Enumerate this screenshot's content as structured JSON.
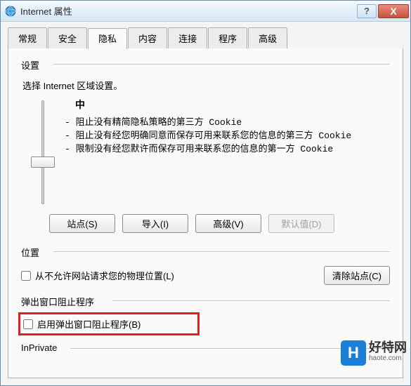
{
  "window": {
    "title": "Internet 属性",
    "help_symbol": "?",
    "close_symbol": "X"
  },
  "tabs": [
    "常规",
    "安全",
    "隐私",
    "内容",
    "连接",
    "程序",
    "高级"
  ],
  "active_tab_index": 2,
  "settings_section": {
    "label": "设置",
    "subtitle": "选择 Internet 区域设置。",
    "level": "中",
    "bullets": [
      "- 阻止没有精简隐私策略的第三方 Cookie",
      "- 阻止没有经您明确同意而保存可用来联系您的信息的第三方 Cookie",
      "- 限制没有经您默许而保存可用来联系您的信息的第一方 Cookie"
    ],
    "buttons": {
      "sites": "站点(S)",
      "import": "导入(I)",
      "advanced": "高级(V)",
      "default": "默认值(D)"
    }
  },
  "location_section": {
    "label": "位置",
    "checkbox_label": "从不允许网站请求您的物理位置(L)",
    "clear_sites": "清除站点(C)"
  },
  "popup_section": {
    "label": "弹出窗口阻止程序",
    "checkbox_label": "启用弹出窗口阻止程序(B)"
  },
  "inprivate_section": {
    "label": "InPrivate"
  },
  "watermark": {
    "badge": "H",
    "main": "好特网",
    "sub": "haote.com"
  }
}
